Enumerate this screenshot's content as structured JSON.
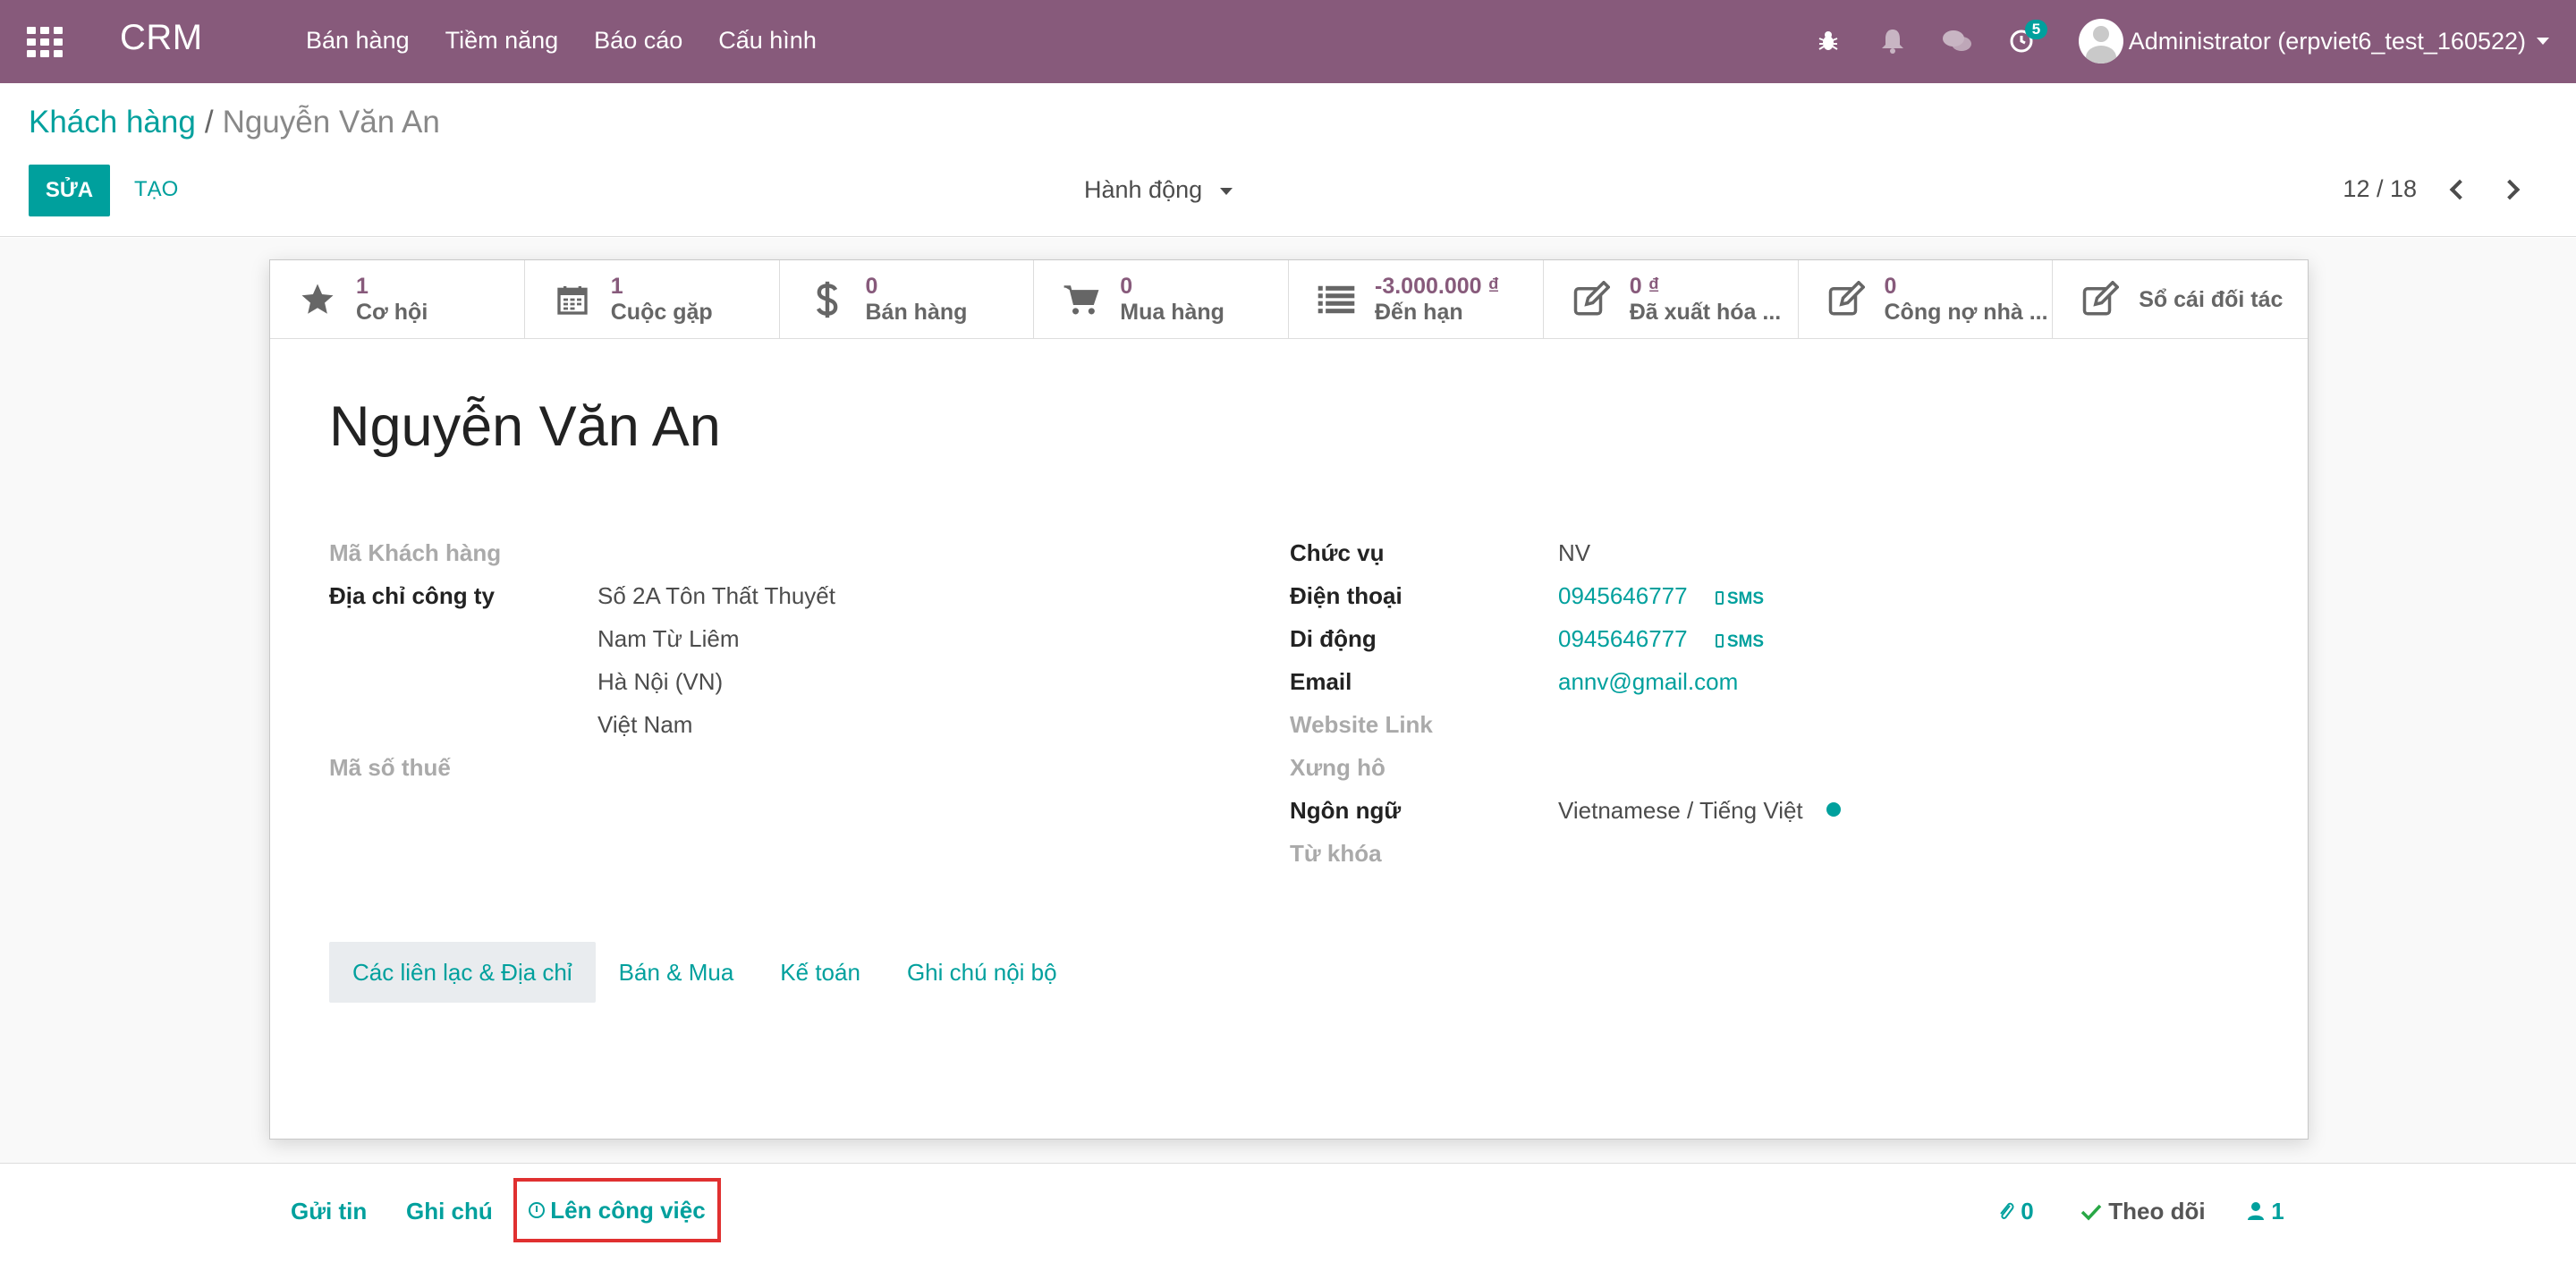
{
  "navbar": {
    "app_name": "CRM",
    "menu": [
      "Bán hàng",
      "Tiềm năng",
      "Báo cáo",
      "Cấu hình"
    ],
    "activity_count": "5",
    "user": "Administrator (erpviet6_test_160522)"
  },
  "breadcrumb": {
    "parent": "Khách hàng",
    "current": "Nguyễn Văn An"
  },
  "toolbar": {
    "edit_label": "SỬA",
    "create_label": "TẠO",
    "action_label": "Hành động",
    "pager": "12 / 18"
  },
  "smart_buttons": [
    {
      "icon": "star-icon",
      "value": "1",
      "label": "Cơ hội"
    },
    {
      "icon": "calendar-icon",
      "value": "1",
      "label": "Cuộc gặp"
    },
    {
      "icon": "dollar-icon",
      "value": "0",
      "label": "Bán hàng"
    },
    {
      "icon": "cart-icon",
      "value": "0",
      "label": "Mua hàng"
    },
    {
      "icon": "list-icon",
      "value": "-3.000.000 ₫",
      "label": "Đến hạn"
    },
    {
      "icon": "edit-icon",
      "value": "0 ₫",
      "label": "Đã xuất hóa ..."
    },
    {
      "icon": "edit-icon",
      "value": "0",
      "label": "Công nợ nhà ..."
    },
    {
      "icon": "edit-icon",
      "label": "Sổ cái đối tác"
    }
  ],
  "partner": {
    "name": "Nguyễn Văn An",
    "left": {
      "customer_code_label": "Mã Khách hàng",
      "address_label": "Địa chỉ công ty",
      "address_lines": [
        "Số 2A Tôn Thất Thuyết",
        "Nam Từ Liêm",
        "Hà Nội (VN)",
        "Việt Nam"
      ],
      "tax_label": "Mã số thuế"
    },
    "right": {
      "job_label": "Chức vụ",
      "job_value": "NV",
      "phone_label": "Điện thoại",
      "phone_value": "0945646777",
      "mobile_label": "Di động",
      "mobile_value": "0945646777",
      "sms_label": "SMS",
      "email_label": "Email",
      "email_value": "annv@gmail.com",
      "website_label": "Website Link",
      "title_label": "Xưng hô",
      "lang_label": "Ngôn ngữ",
      "lang_value": "Vietnamese / Tiếng Việt",
      "tags_label": "Từ khóa"
    }
  },
  "tabs": [
    "Các liên lạc & Địa chỉ",
    "Bán & Mua",
    "Kế toán",
    "Ghi chú nội bộ"
  ],
  "chatter": {
    "send_message": "Gửi tin",
    "log_note": "Ghi chú",
    "schedule_activity": "Lên công việc",
    "attachments": "0",
    "follow": "Theo dõi",
    "followers": "1"
  },
  "colors": {
    "navbar": "#875a7b",
    "accent": "#00a09d",
    "highlight_box": "#e03030"
  }
}
